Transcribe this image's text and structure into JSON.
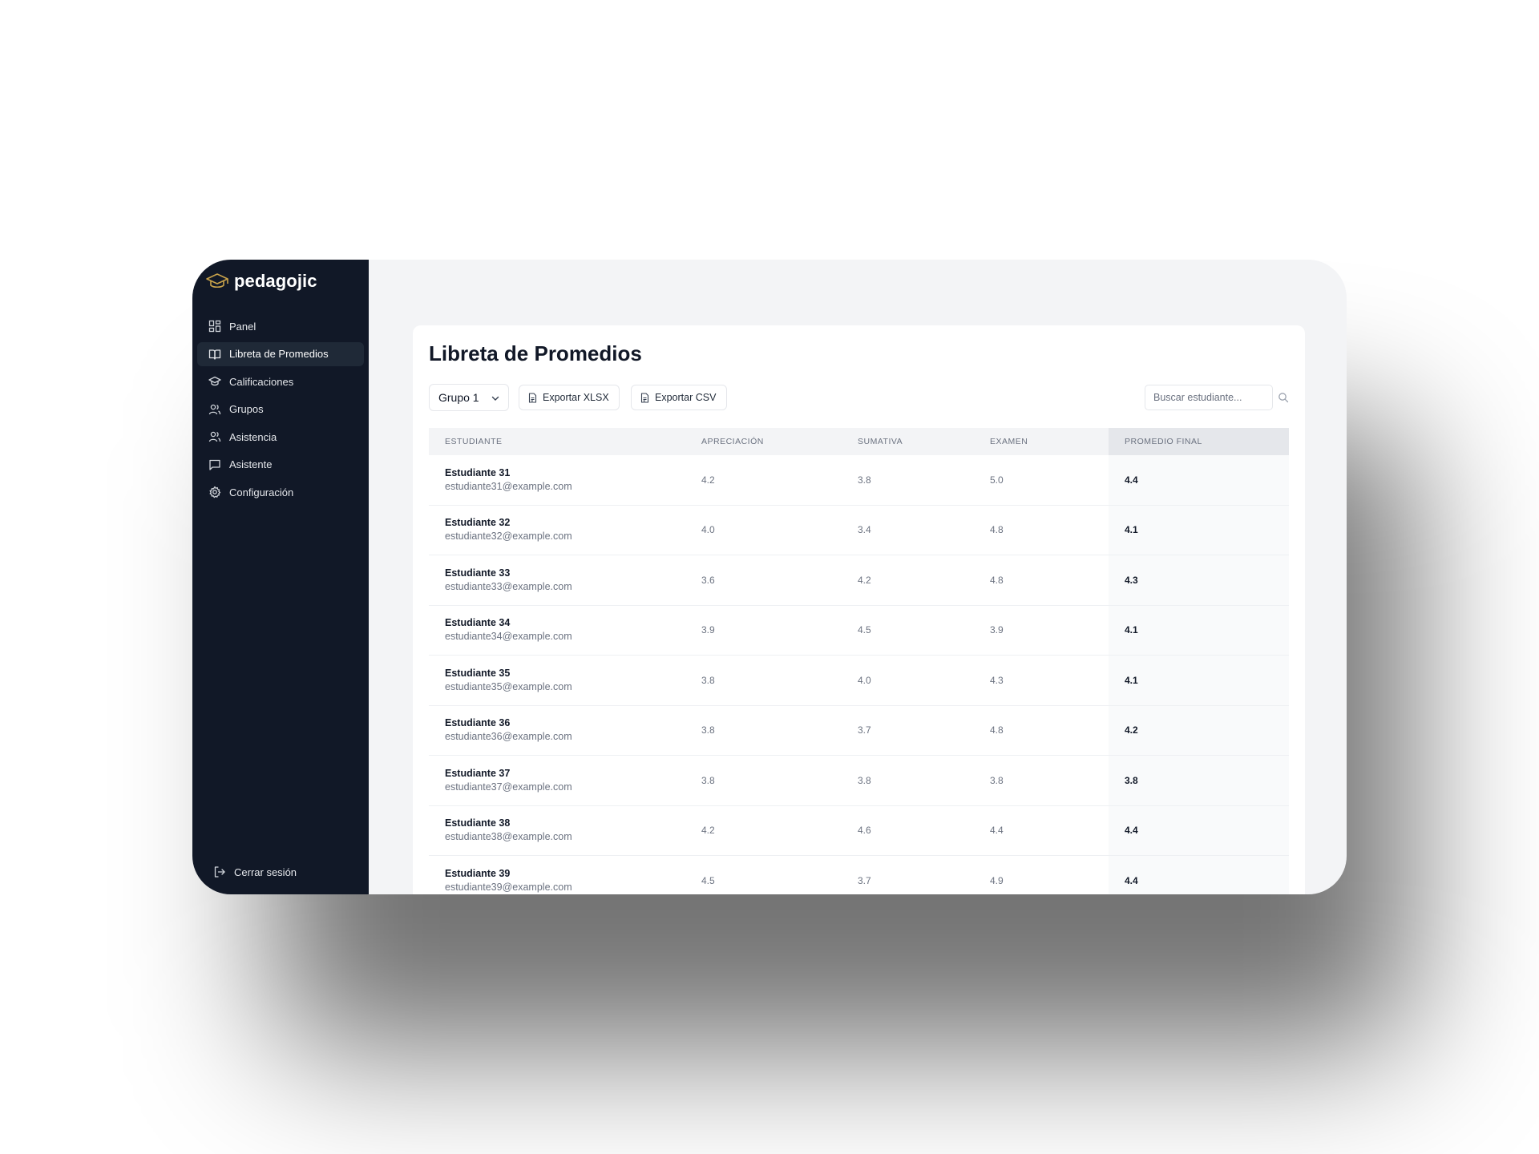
{
  "app": {
    "name": "pedagojic"
  },
  "sidebar": {
    "items": [
      {
        "label": "Panel",
        "icon": "dashboard-icon",
        "active": false
      },
      {
        "label": "Libreta de Promedios",
        "icon": "book-open-icon",
        "active": true
      },
      {
        "label": "Calificaciones",
        "icon": "graduation-cap-icon",
        "active": false
      },
      {
        "label": "Grupos",
        "icon": "users-icon",
        "active": false
      },
      {
        "label": "Asistencia",
        "icon": "users-icon",
        "active": false
      },
      {
        "label": "Asistente",
        "icon": "message-square-icon",
        "active": false
      },
      {
        "label": "Configuración",
        "icon": "gear-icon",
        "active": false
      }
    ],
    "logout_label": "Cerrar sesión"
  },
  "main": {
    "title": "Libreta de Promedios",
    "group_select": "Grupo 1",
    "export_xlsx": "Exportar XLSX",
    "export_csv": "Exportar CSV",
    "search_placeholder": "Buscar estudiante..."
  },
  "table": {
    "headers": [
      "ESTUDIANTE",
      "APRECIACIÓN",
      "SUMATIVA",
      "EXAMEN",
      "PROMEDIO FINAL"
    ],
    "rows": [
      {
        "name": "Estudiante 31",
        "email": "estudiante31@example.com",
        "apreciacion": "4.2",
        "sumativa": "3.8",
        "examen": "5.0",
        "promedio": "4.4"
      },
      {
        "name": "Estudiante 32",
        "email": "estudiante32@example.com",
        "apreciacion": "4.0",
        "sumativa": "3.4",
        "examen": "4.8",
        "promedio": "4.1"
      },
      {
        "name": "Estudiante 33",
        "email": "estudiante33@example.com",
        "apreciacion": "3.6",
        "sumativa": "4.2",
        "examen": "4.8",
        "promedio": "4.3"
      },
      {
        "name": "Estudiante 34",
        "email": "estudiante34@example.com",
        "apreciacion": "3.9",
        "sumativa": "4.5",
        "examen": "3.9",
        "promedio": "4.1"
      },
      {
        "name": "Estudiante 35",
        "email": "estudiante35@example.com",
        "apreciacion": "3.8",
        "sumativa": "4.0",
        "examen": "4.3",
        "promedio": "4.1"
      },
      {
        "name": "Estudiante 36",
        "email": "estudiante36@example.com",
        "apreciacion": "3.8",
        "sumativa": "3.7",
        "examen": "4.8",
        "promedio": "4.2"
      },
      {
        "name": "Estudiante 37",
        "email": "estudiante37@example.com",
        "apreciacion": "3.8",
        "sumativa": "3.8",
        "examen": "3.8",
        "promedio": "3.8"
      },
      {
        "name": "Estudiante 38",
        "email": "estudiante38@example.com",
        "apreciacion": "4.2",
        "sumativa": "4.6",
        "examen": "4.4",
        "promedio": "4.4"
      },
      {
        "name": "Estudiante 39",
        "email": "estudiante39@example.com",
        "apreciacion": "4.5",
        "sumativa": "3.7",
        "examen": "4.9",
        "promedio": "4.4"
      }
    ]
  },
  "colors": {
    "sidebar_bg": "#111827",
    "sidebar_active": "#1f2937",
    "main_bg": "#f3f4f6",
    "logo_accent": "#c8a24a"
  }
}
